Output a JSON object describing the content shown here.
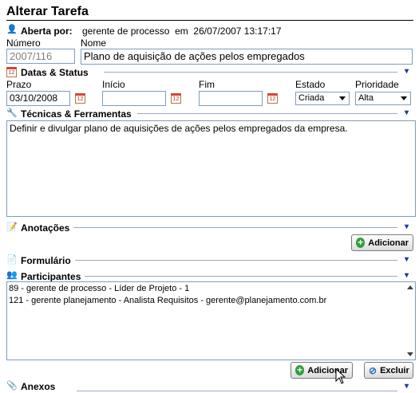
{
  "page": {
    "title": "Alterar Tarefa"
  },
  "header": {
    "opened_by_label": "Aberta por:",
    "opened_by_value": "gerente de processo  em  26/07/2007 13:17:17"
  },
  "fields": {
    "numero_label": "Número",
    "numero_value": "2007/116",
    "nome_label": "Nome",
    "nome_value": "Plano de aquisição de ações pelos empregados"
  },
  "dates_section": {
    "title": "Datas & Status",
    "prazo_label": "Prazo",
    "prazo_value": "03/10/2008",
    "inicio_label": "Início",
    "inicio_value": "",
    "fim_label": "Fim",
    "fim_value": "",
    "estado_label": "Estado",
    "estado_value": "Criada",
    "prioridade_label": "Prioridade",
    "prioridade_value": "Alta",
    "calendar_icon_text": "12"
  },
  "tecnicas_section": {
    "title": "Técnicas & Ferramentas",
    "text": "Definir e divulgar plano de aquisições de ações pelos empregados da empresa."
  },
  "anotacoes_section": {
    "title": "Anotações",
    "add_label": "Adicionar"
  },
  "formulario_section": {
    "title": "Formulário"
  },
  "participantes_section": {
    "title": "Participantes",
    "items": [
      "89 - gerente de processo - Líder de Projeto - 1",
      "121 - gerente planejamento - Analista Requisitos - gerente@planejamento.com.br"
    ],
    "add_label": "Adicionar",
    "remove_label": "Excluir"
  },
  "anexos_section": {
    "title": "Anexos"
  },
  "colors": {
    "accent": "#1c3c9c",
    "add_icon": "#2f9e3a"
  }
}
